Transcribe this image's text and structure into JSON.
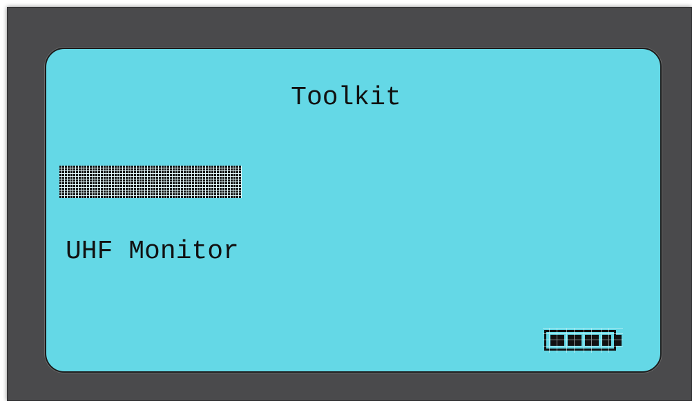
{
  "screen": {
    "title": "Toolkit",
    "selected_item_label": "",
    "menu_items": [
      "UHF Monitor"
    ],
    "battery_icon": "battery-icon",
    "battery_level": 1.0
  },
  "colors": {
    "screen_background": "#64d8e6",
    "device_frame": "#4a4a4c",
    "text": "#111111"
  }
}
